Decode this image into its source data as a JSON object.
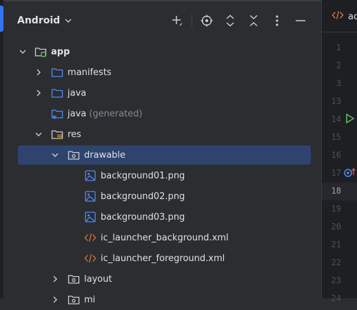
{
  "panel": {
    "title": "Android",
    "actions": [
      "add-icon",
      "locate-icon",
      "expand-all-icon",
      "collapse-all-icon",
      "more-icon",
      "hide-icon"
    ]
  },
  "tree": {
    "rows": [
      {
        "label": "app",
        "suffix": "",
        "bold": true,
        "expanded": true,
        "icon": "module-folder-icon"
      },
      {
        "label": "manifests",
        "suffix": "",
        "expanded": false,
        "icon": "folder-icon"
      },
      {
        "label": "java",
        "suffix": "",
        "expanded": false,
        "icon": "folder-icon"
      },
      {
        "label": "java",
        "suffix": "(generated)",
        "expanded": null,
        "icon": "generated-folder-icon"
      },
      {
        "label": "res",
        "suffix": "",
        "expanded": true,
        "icon": "resources-folder-icon"
      },
      {
        "label": "drawable",
        "suffix": "",
        "expanded": true,
        "selected": true,
        "icon": "package-folder-icon"
      },
      {
        "label": "background01.png",
        "suffix": "",
        "icon": "image-file-icon"
      },
      {
        "label": "background02.png",
        "suffix": "",
        "icon": "image-file-icon"
      },
      {
        "label": "background03.png",
        "suffix": "",
        "icon": "image-file-icon"
      },
      {
        "label": "ic_launcher_background.xml",
        "suffix": "",
        "icon": "xml-file-icon"
      },
      {
        "label": "ic_launcher_foreground.xml",
        "suffix": "",
        "icon": "xml-file-icon"
      },
      {
        "label": "layout",
        "suffix": "",
        "expanded": false,
        "icon": "package-folder-icon"
      },
      {
        "label": "mi",
        "suffix": "",
        "expanded": false,
        "icon": "package-folder-icon"
      }
    ]
  },
  "editor": {
    "tab_label": "ac",
    "line_numbers": [
      "1",
      "2",
      "3",
      "13",
      "14",
      "15",
      "16",
      "17",
      "18",
      "19",
      "20",
      "21",
      "22",
      "23",
      "24"
    ],
    "current_line": "18"
  },
  "colors": {
    "selection": "#2e436e",
    "accent": "#3574f0",
    "folder_blue": "#548af7",
    "xml_orange": "#e07b3c",
    "run_green": "#5fb865"
  }
}
